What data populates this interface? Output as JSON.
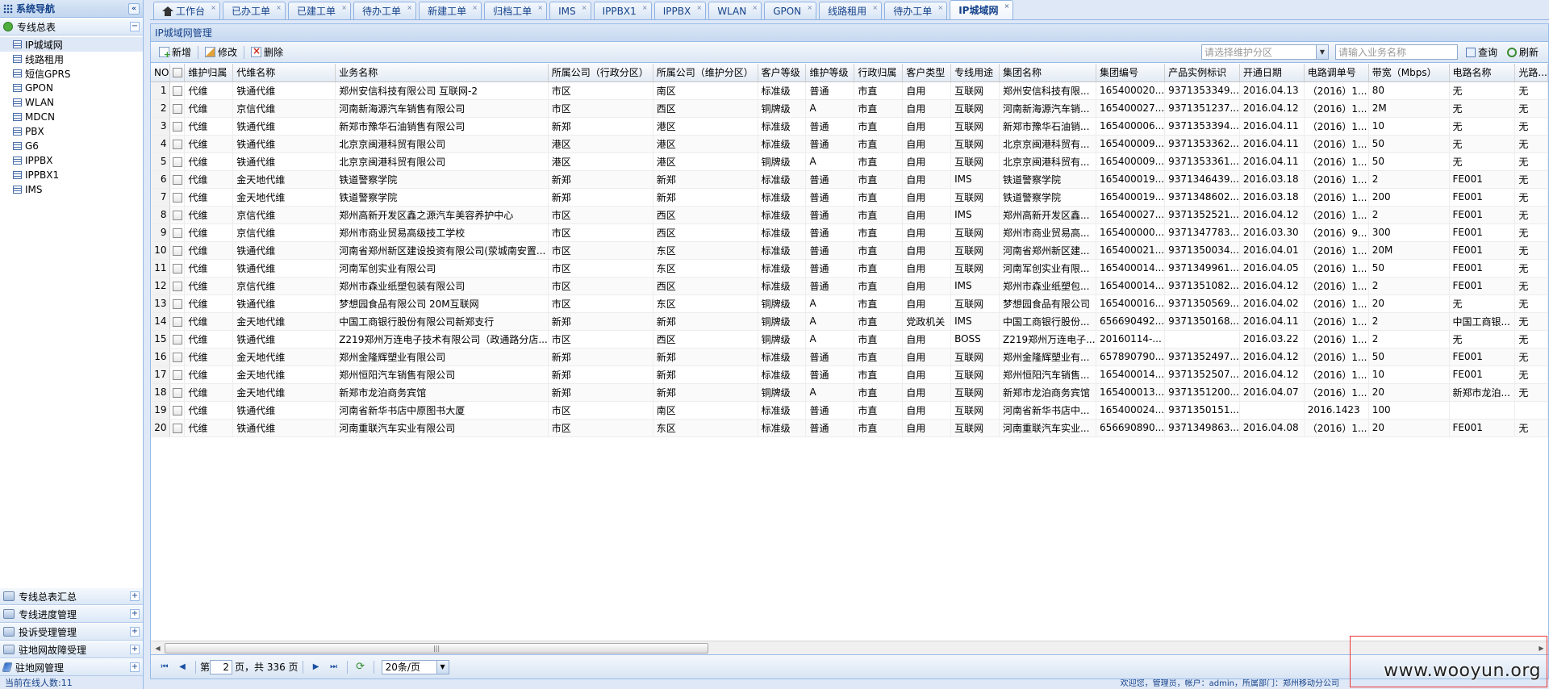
{
  "sidebar": {
    "title": "系统导航",
    "collapse_icon": "«",
    "group_top": {
      "label": "专线总表",
      "toggle": "−"
    },
    "tree": [
      {
        "label": "IP城域网",
        "selected": true
      },
      {
        "label": "线路租用"
      },
      {
        "label": "短信GPRS"
      },
      {
        "label": "GPON"
      },
      {
        "label": "WLAN"
      },
      {
        "label": "MDCN"
      },
      {
        "label": "PBX"
      },
      {
        "label": "G6"
      },
      {
        "label": "IPPBX"
      },
      {
        "label": "IPPBX1"
      },
      {
        "label": "IMS"
      }
    ],
    "groups_bottom": [
      {
        "label": "专线总表汇总",
        "toggle": "+"
      },
      {
        "label": "专线进度管理",
        "toggle": "+"
      },
      {
        "label": "投诉受理管理",
        "toggle": "+"
      },
      {
        "label": "驻地网故障受理",
        "toggle": "+"
      },
      {
        "label": "驻地网管理",
        "toggle": "+"
      }
    ],
    "footer": "当前在线人数:11"
  },
  "tabs": [
    {
      "label": "工作台",
      "home": true
    },
    {
      "label": "已办工单"
    },
    {
      "label": "已建工单"
    },
    {
      "label": "待办工单"
    },
    {
      "label": "新建工单"
    },
    {
      "label": "归档工单"
    },
    {
      "label": "IMS"
    },
    {
      "label": "IPPBX1"
    },
    {
      "label": "IPPBX"
    },
    {
      "label": "WLAN"
    },
    {
      "label": "GPON"
    },
    {
      "label": "线路租用"
    },
    {
      "label": "待办工单"
    },
    {
      "label": "IP城域网",
      "active": true
    }
  ],
  "tab_close": "×",
  "panel": {
    "title": "IP城域网管理"
  },
  "toolbar": {
    "add": "新增",
    "edit": "修改",
    "delete": "删除",
    "combo_placeholder": "请选择维护分区",
    "search_placeholder": "请输入业务名称",
    "query": "查询",
    "refresh": "刷新",
    "combo_trigger": "▼"
  },
  "grid": {
    "columns": [
      "NO",
      "",
      "维护归属",
      "代维名称",
      "业务名称",
      "所属公司（行政分区）",
      "所属公司（维护分区）",
      "客户等级",
      "维护等级",
      "行政归属",
      "客户类型",
      "专线用途",
      "集团名称",
      "集团编号",
      "产品实例标识",
      "开通日期",
      "电路调单号",
      "带宽（Mbps）",
      "电路名称",
      "光路..."
    ],
    "rows": [
      [
        "1",
        "代维",
        "铁通代维",
        "郑州安信科技有限公司 互联网-2",
        "市区",
        "南区",
        "标准级",
        "普通",
        "市直",
        "自用",
        "互联网",
        "郑州安信科技有限...",
        "165400020...",
        "9371353349...",
        "2016.04.13",
        "（2016）1...",
        "80",
        "无",
        "无"
      ],
      [
        "2",
        "代维",
        "京信代维",
        "河南新海源汽车销售有限公司",
        "市区",
        "西区",
        "铜牌级",
        "A",
        "市直",
        "自用",
        "互联网",
        "河南新海源汽车销...",
        "165400027...",
        "9371351237...",
        "2016.04.12",
        "（2016）1...",
        "2M",
        "无",
        "无"
      ],
      [
        "3",
        "代维",
        "铁通代维",
        "新郑市豫华石油销售有限公司",
        "新郑",
        "港区",
        "标准级",
        "普通",
        "市直",
        "自用",
        "互联网",
        "新郑市豫华石油销...",
        "165400006...",
        "9371353394...",
        "2016.04.11",
        "（2016）1...",
        "10",
        "无",
        "无"
      ],
      [
        "4",
        "代维",
        "铁通代维",
        "北京京闽港科贸有限公司",
        "港区",
        "港区",
        "标准级",
        "普通",
        "市直",
        "自用",
        "互联网",
        "北京京闽港科贸有...",
        "165400009...",
        "9371353362...",
        "2016.04.11",
        "（2016）1...",
        "50",
        "无",
        "无"
      ],
      [
        "5",
        "代维",
        "铁通代维",
        "北京京闽港科贸有限公司",
        "港区",
        "港区",
        "铜牌级",
        "A",
        "市直",
        "自用",
        "互联网",
        "北京京闽港科贸有...",
        "165400009...",
        "9371353361...",
        "2016.04.11",
        "（2016）1...",
        "50",
        "无",
        "无"
      ],
      [
        "6",
        "代维",
        "金天地代维",
        "铁道警察学院",
        "新郑",
        "新郑",
        "标准级",
        "普通",
        "市直",
        "自用",
        "IMS",
        "铁道警察学院",
        "165400019...",
        "9371346439...",
        "2016.03.18",
        "（2016）1...",
        "2",
        "FE001",
        "无"
      ],
      [
        "7",
        "代维",
        "金天地代维",
        "铁道警察学院",
        "新郑",
        "新郑",
        "标准级",
        "普通",
        "市直",
        "自用",
        "互联网",
        "铁道警察学院",
        "165400019...",
        "9371348602...",
        "2016.03.18",
        "（2016）1...",
        "200",
        "FE001",
        "无"
      ],
      [
        "8",
        "代维",
        "京信代维",
        "郑州高新开发区鑫之源汽车美容养护中心",
        "市区",
        "西区",
        "标准级",
        "普通",
        "市直",
        "自用",
        "IMS",
        "郑州高新开发区鑫...",
        "165400027...",
        "9371352521...",
        "2016.04.12",
        "（2016）1...",
        "2",
        "FE001",
        "无"
      ],
      [
        "9",
        "代维",
        "京信代维",
        "郑州市商业贸易高级技工学校",
        "市区",
        "西区",
        "标准级",
        "普通",
        "市直",
        "自用",
        "互联网",
        "郑州市商业贸易高...",
        "165400000...",
        "9371347783...",
        "2016.03.30",
        "（2016）9...",
        "300",
        "FE001",
        "无"
      ],
      [
        "10",
        "代维",
        "铁通代维",
        "河南省郑州新区建设投资有限公司(荥城南安置...",
        "市区",
        "东区",
        "标准级",
        "普通",
        "市直",
        "自用",
        "互联网",
        "河南省郑州新区建...",
        "165400021...",
        "9371350034...",
        "2016.04.01",
        "（2016）1...",
        "20M",
        "FE001",
        "无"
      ],
      [
        "11",
        "代维",
        "铁通代维",
        "河南军创实业有限公司",
        "市区",
        "东区",
        "标准级",
        "普通",
        "市直",
        "自用",
        "互联网",
        "河南军创实业有限...",
        "165400014...",
        "9371349961...",
        "2016.04.05",
        "（2016）1...",
        "50",
        "FE001",
        "无"
      ],
      [
        "12",
        "代维",
        "京信代维",
        "郑州市森业纸塑包装有限公司",
        "市区",
        "西区",
        "标准级",
        "普通",
        "市直",
        "自用",
        "IMS",
        "郑州市森业纸塑包...",
        "165400014...",
        "9371351082...",
        "2016.04.12",
        "（2016）1...",
        "2",
        "FE001",
        "无"
      ],
      [
        "13",
        "代维",
        "铁通代维",
        "梦想园食品有限公司 20M互联网",
        "市区",
        "东区",
        "铜牌级",
        "A",
        "市直",
        "自用",
        "互联网",
        "梦想园食品有限公司",
        "165400016...",
        "9371350569...",
        "2016.04.02",
        "（2016）1...",
        "20",
        "无",
        "无"
      ],
      [
        "14",
        "代维",
        "金天地代维",
        "中国工商银行股份有限公司新郑支行",
        "新郑",
        "新郑",
        "铜牌级",
        "A",
        "市直",
        "党政机关",
        "IMS",
        "中国工商银行股份...",
        "656690492...",
        "9371350168...",
        "2016.04.11",
        "（2016）1...",
        "2",
        "中国工商银...",
        "无"
      ],
      [
        "15",
        "代维",
        "铁通代维",
        "Z219郑州万连电子技术有限公司（政通路分店...",
        "市区",
        "西区",
        "铜牌级",
        "A",
        "市直",
        "自用",
        "BOSS",
        "Z219郑州万连电子...",
        "20160114-...",
        "",
        "2016.03.22",
        "（2016）1...",
        "2",
        "无",
        "无"
      ],
      [
        "16",
        "代维",
        "金天地代维",
        "郑州金隆辉塑业有限公司",
        "新郑",
        "新郑",
        "标准级",
        "普通",
        "市直",
        "自用",
        "互联网",
        "郑州金隆辉塑业有...",
        "657890790...",
        "9371352497...",
        "2016.04.12",
        "（2016）1...",
        "50",
        "FE001",
        "无"
      ],
      [
        "17",
        "代维",
        "金天地代维",
        "郑州恒阳汽车销售有限公司",
        "新郑",
        "新郑",
        "标准级",
        "普通",
        "市直",
        "自用",
        "互联网",
        "郑州恒阳汽车销售...",
        "165400014...",
        "9371352507...",
        "2016.04.12",
        "（2016）1...",
        "10",
        "FE001",
        "无"
      ],
      [
        "18",
        "代维",
        "金天地代维",
        "新郑市龙泊商务宾馆",
        "新郑",
        "新郑",
        "铜牌级",
        "A",
        "市直",
        "自用",
        "互联网",
        "新郑市龙泊商务宾馆",
        "165400013...",
        "9371351200...",
        "2016.04.07",
        "（2016）1...",
        "20",
        "新郑市龙泊...",
        "无"
      ],
      [
        "19",
        "代维",
        "铁通代维",
        "河南省新华书店中原图书大厦",
        "市区",
        "南区",
        "标准级",
        "普通",
        "市直",
        "自用",
        "互联网",
        "河南省新华书店中...",
        "165400024...",
        "9371350151...",
        "",
        "2016.1423",
        "100",
        "",
        ""
      ],
      [
        "20",
        "代维",
        "铁通代维",
        "河南重联汽车实业有限公司",
        "市区",
        "东区",
        "标准级",
        "普通",
        "市直",
        "自用",
        "互联网",
        "河南重联汽车实业...",
        "656690890...",
        "9371349863...",
        "2016.04.08",
        "（2016）1...",
        "20",
        "FE001",
        "无"
      ]
    ]
  },
  "scrollbar": {
    "left": "◀",
    "right": "▶",
    "grip": "|||"
  },
  "pager": {
    "first": "⏮",
    "prev": "◀",
    "page_label": "第",
    "page_value": "2",
    "of_label": "页，共 336 页",
    "next": "▶",
    "last": "⏭",
    "refresh": "⟳",
    "page_size": "20条/页",
    "size_trigger": "▼"
  },
  "status_text": "欢迎您，管理员，帐户：admin，所属部门：郑州移动分公司",
  "watermark": "www.wooyun.org"
}
